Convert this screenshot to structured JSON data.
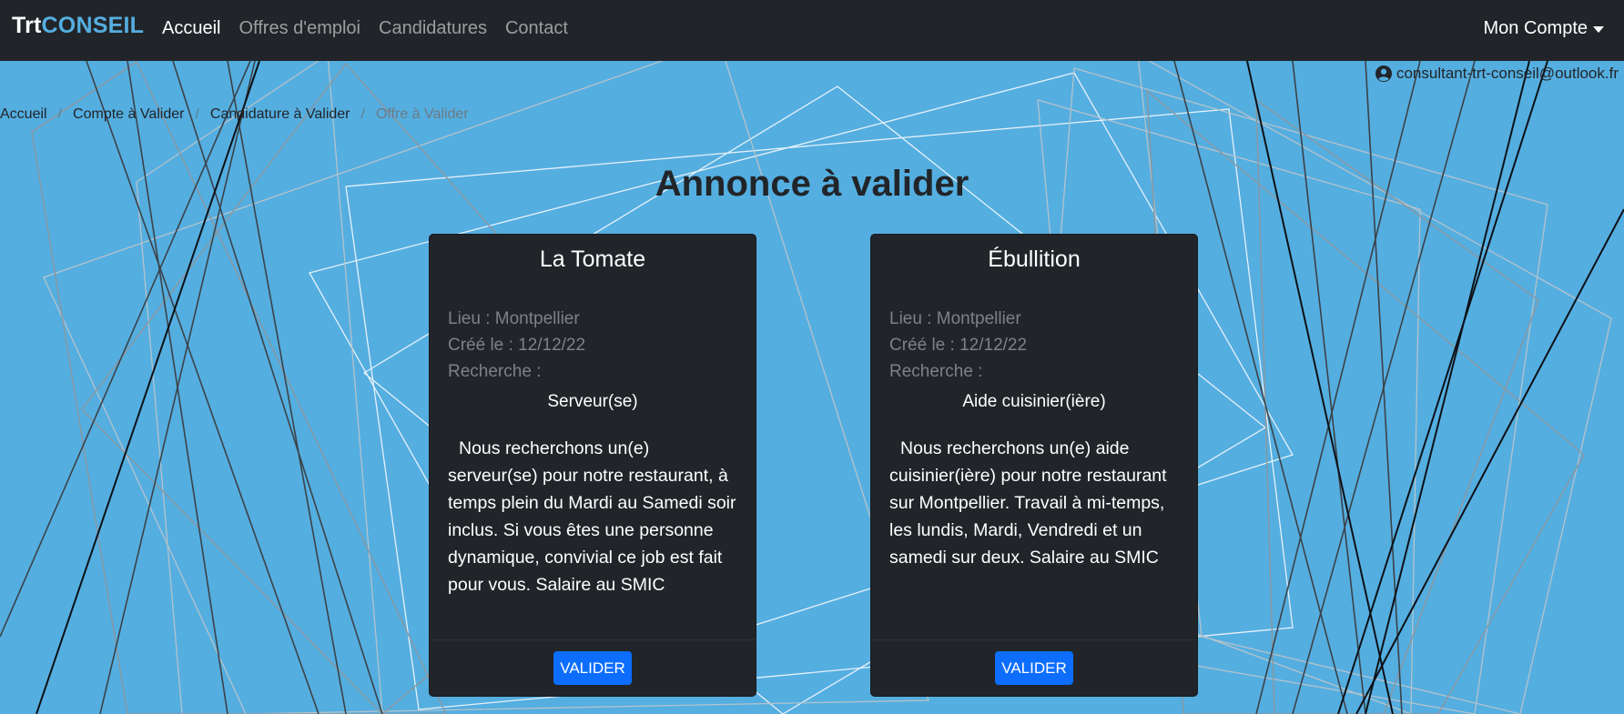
{
  "navbar": {
    "brand_part1": "Trt",
    "brand_part2": "CONSEIL",
    "links": [
      "Accueil",
      "Offres d'emploi",
      "Candidatures",
      "Contact"
    ],
    "account_label": "Mon Compte"
  },
  "user": {
    "email": "consultant-trt-conseil@outlook.fr"
  },
  "breadcrumb": [
    "Accueil",
    "Compte à Valider",
    "Candidature à Valider",
    "Offre à Valider"
  ],
  "page_title": "Annonce à valider",
  "cards": [
    {
      "title": "La Tomate",
      "lieu": "Lieu : Montpellier",
      "cree": "Créé le : 12/12/22",
      "recherche": "Recherche :",
      "job": "Serveur(se)",
      "description": "Nous recherchons un(e) serveur(se) pour notre restaurant, à temps plein du Mardi au Samedi soir inclus. Si vous êtes une personne dynamique, convivial ce job est fait pour vous. Salaire au SMIC",
      "button": "VALIDER"
    },
    {
      "title": "Ébullition",
      "lieu": "Lieu : Montpellier",
      "cree": "Créé le : 12/12/22",
      "recherche": "Recherche :",
      "job": "Aide cuisinier(ière)",
      "description": "Nous recherchons un(e) aide cuisinier(ière) pour notre restaurant sur Montpellier. Travail à mi-temps, les lundis, Mardi, Vendredi et un samedi sur deux. Salaire au SMIC",
      "button": "VALIDER"
    }
  ],
  "colors": {
    "background": "#55aee0",
    "navbar": "#212529",
    "brand_accent": "#55aee0",
    "card": "#212529",
    "button": "#0d6efd"
  },
  "icons": {
    "user": "user-circle-icon",
    "dropdown": "caret-down-icon"
  }
}
